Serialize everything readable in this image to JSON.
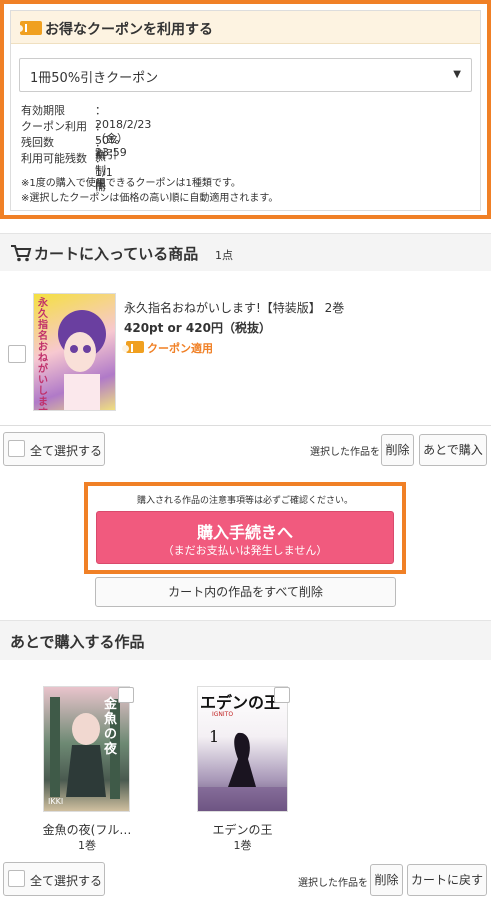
{
  "coupon": {
    "title": "お得なクーポンを利用する",
    "selected": "1冊50%引きクーポン",
    "rows": [
      {
        "label": "有効期限",
        "value": "：2018/2/23（金）23:59"
      },
      {
        "label": "クーポン利用",
        "value": "：50%割引"
      },
      {
        "label": "残回数",
        "value": "：無制限"
      },
      {
        "label": "利用可能残数",
        "value": "：1/1冊"
      }
    ],
    "notes": [
      "※1度の購入で使用できるクーポンは1種類です。",
      "※選択したクーポンは価格の高い順に自動適用されます。"
    ]
  },
  "cart": {
    "title": "カートに入っている商品",
    "count": "1点",
    "item": {
      "title": "永久指名おねがいします!【特装版】 2巻",
      "price": "420pt or 420円（税抜）",
      "coupon_badge": "クーポン適用",
      "cover_text": "永久指名おねがいします"
    },
    "select_all": "全て選択する",
    "selected_label": "選択した作品を",
    "delete": "削除",
    "later": "あとで購入"
  },
  "purchase": {
    "notice": "購入される作品の注意事項等は必ずご確認ください。",
    "button": "購入手続きへ",
    "button_sub": "（まだお支払いは発生しません）",
    "clear_cart": "カート内の作品をすべて削除"
  },
  "later_section": {
    "title": "あとで購入する作品",
    "items": [
      {
        "title": "金魚の夜(フル…",
        "volume": "1巻",
        "cover_text": "金魚の夜",
        "cover_sub": "IKKI"
      },
      {
        "title": "エデンの王",
        "volume": "1巻",
        "cover_text": "エデンの王",
        "cover_sub": "IGNITO"
      }
    ],
    "select_all": "全て選択する",
    "selected_label": "選択した作品を",
    "delete": "削除",
    "return": "カートに戻す"
  },
  "colors": {
    "accent": "#f08026",
    "buy": "#f15a7e",
    "coupon_tag": "#f0a020"
  }
}
